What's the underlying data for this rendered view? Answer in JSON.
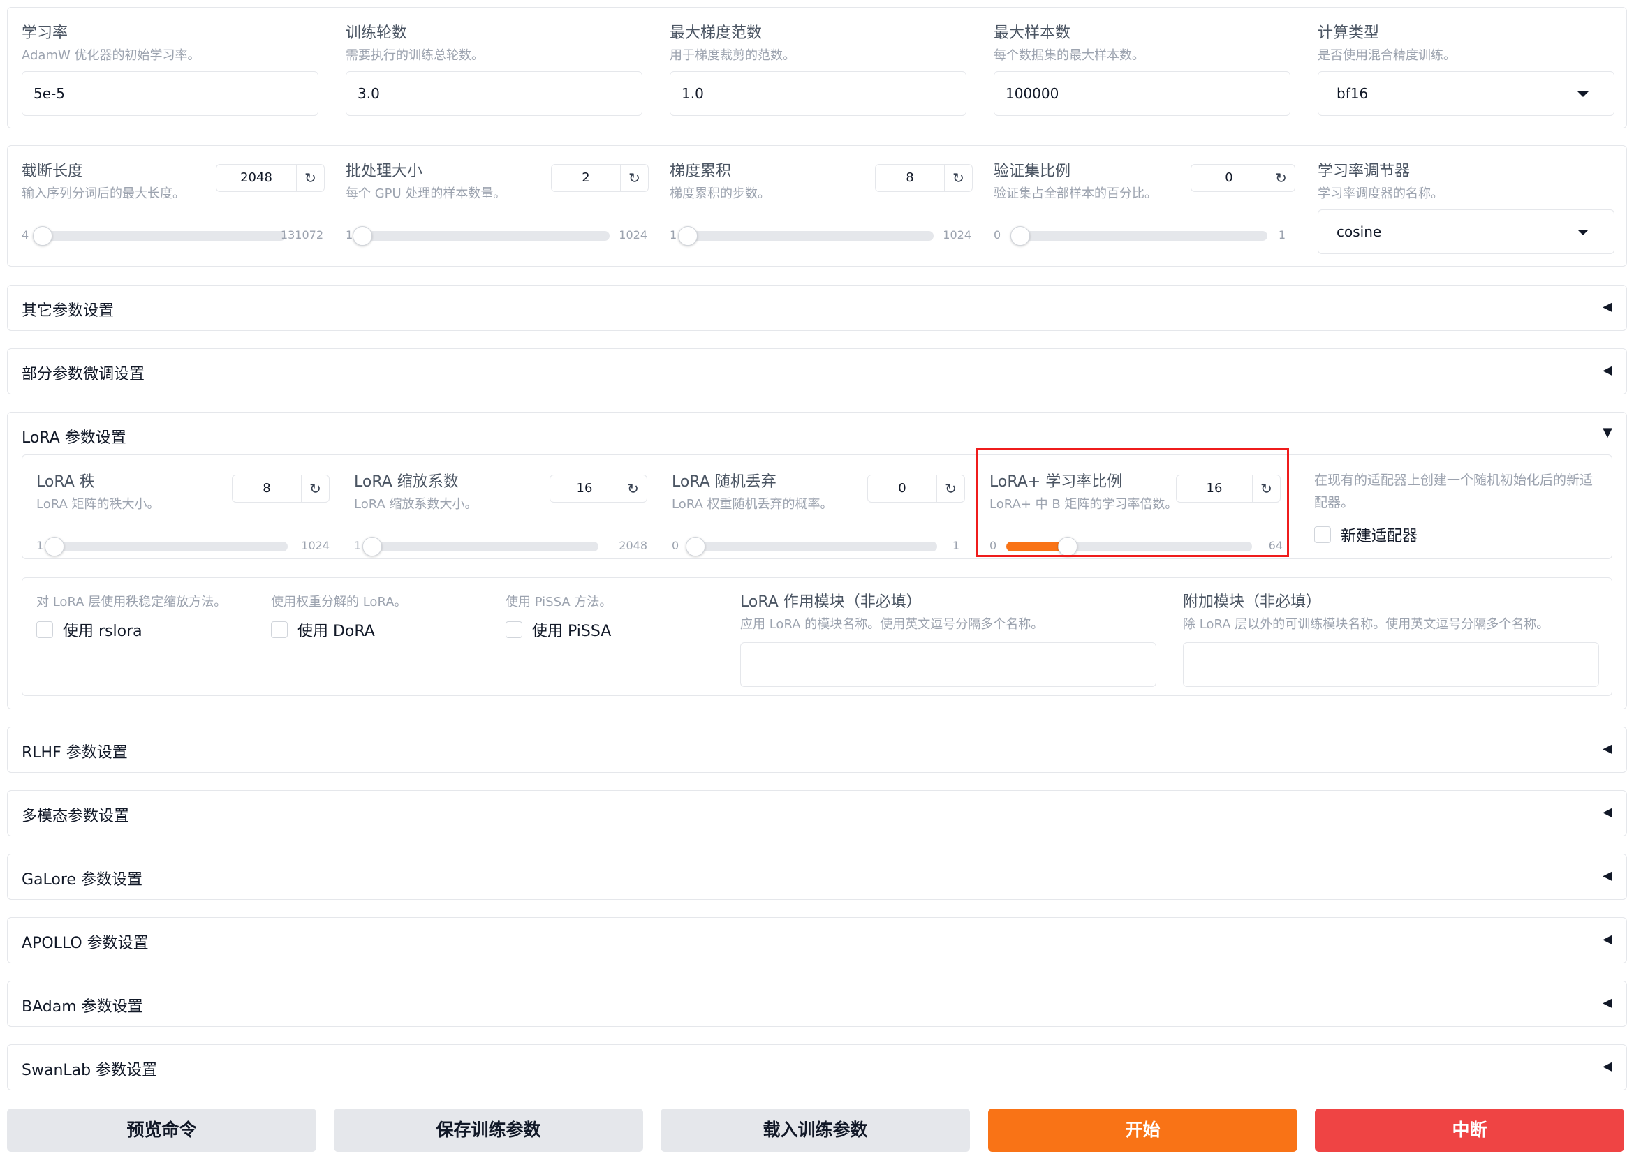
{
  "row1": {
    "learning_rate": {
      "label": "学习率",
      "info": "AdamW 优化器的初始学习率。",
      "value": "5e-5"
    },
    "epochs": {
      "label": "训练轮数",
      "info": "需要执行的训练总轮数。",
      "value": "3.0"
    },
    "max_grad_norm": {
      "label": "最大梯度范数",
      "info": "用于梯度裁剪的范数。",
      "value": "1.0"
    },
    "max_samples": {
      "label": "最大样本数",
      "info": "每个数据集的最大样本数。",
      "value": "100000"
    },
    "compute_type": {
      "label": "计算类型",
      "info": "是否使用混合精度训练。",
      "value": "bf16"
    }
  },
  "row2": {
    "cutoff_len": {
      "label": "截断长度",
      "info": "输入序列分词后的最大长度。",
      "value": "2048",
      "min": "4",
      "max": "131072",
      "fraction": 0.016
    },
    "batch_size": {
      "label": "批处理大小",
      "info": "每个 GPU 处理的样本数量。",
      "value": "2",
      "min": "1",
      "max": "1024",
      "fraction": 0.001
    },
    "grad_accum": {
      "label": "梯度累积",
      "info": "梯度累积的步数。",
      "value": "8",
      "min": "1",
      "max": "1024",
      "fraction": 0.007
    },
    "val_size": {
      "label": "验证集比例",
      "info": "验证集占全部样本的百分比。",
      "value": "0",
      "min": "0",
      "max": "1",
      "fraction": 0
    },
    "lr_scheduler": {
      "label": "学习率调节器",
      "info": "学习率调度器的名称。",
      "value": "cosine"
    }
  },
  "accordions_top": [
    "其它参数设置",
    "部分参数微调设置"
  ],
  "lora": {
    "title": "LoRA 参数设置",
    "rank": {
      "label": "LoRA 秩",
      "info": "LoRA 矩阵的秩大小。",
      "value": "8",
      "min": "1",
      "max": "1024",
      "fraction": 0.007
    },
    "alpha": {
      "label": "LoRA 缩放系数",
      "info": "LoRA 缩放系数大小。",
      "value": "16",
      "min": "1",
      "max": "2048",
      "fraction": 0.007
    },
    "dropout": {
      "label": "LoRA 随机丢弃",
      "info": "LoRA 权重随机丢弃的概率。",
      "value": "0",
      "min": "0",
      "max": "1",
      "fraction": 0
    },
    "lr_ratio": {
      "label": "LoRA+ 学习率比例",
      "info": "LoRA+ 中 B 矩阵的学习率倍数。",
      "value": "16",
      "min": "0",
      "max": "64",
      "fraction": 0.25
    },
    "new_adapter": {
      "info": "在现有的适配器上创建一个随机初始化后的新适配器。",
      "label": "新建适配器"
    },
    "rslora": {
      "info": "对 LoRA 层使用秩稳定缩放方法。",
      "label": "使用 rslora"
    },
    "dora": {
      "info": "使用权重分解的 LoRA。",
      "label": "使用 DoRA"
    },
    "pissa": {
      "info": "使用 PiSSA 方法。",
      "label": "使用 PiSSA"
    },
    "target": {
      "label": "LoRA 作用模块（非必填）",
      "info": "应用 LoRA 的模块名称。使用英文逗号分隔多个名称。",
      "value": ""
    },
    "additional": {
      "label": "附加模块（非必填）",
      "info": "除 LoRA 层以外的可训练模块名称。使用英文逗号分隔多个名称。",
      "value": ""
    }
  },
  "accordions_bottom": [
    "RLHF 参数设置",
    "多模态参数设置",
    "GaLore 参数设置",
    "APOLLO 参数设置",
    "BAdam 参数设置",
    "SwanLab 参数设置"
  ],
  "buttons": {
    "preview": "预览命令",
    "save": "保存训练参数",
    "load": "载入训练参数",
    "start": "开始",
    "abort": "中断"
  },
  "icons": {
    "reset": "reset-icon",
    "collapsed": "triangle-left-icon",
    "expanded": "triangle-down-icon",
    "dropdown": "caret-down-icon"
  },
  "colors": {
    "accent": "#f97316",
    "danger": "#ef4444",
    "highlight": "#ef1c1c"
  }
}
